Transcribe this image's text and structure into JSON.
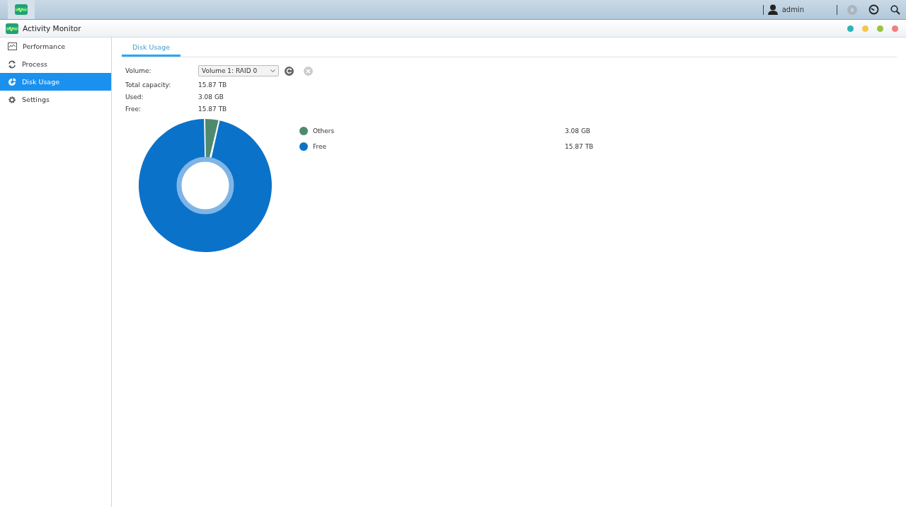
{
  "taskbar": {
    "user": "admin"
  },
  "window": {
    "title": "Activity Monitor",
    "controls": [
      {
        "color": "#2eb3b5"
      },
      {
        "color": "#f5c74a"
      },
      {
        "color": "#9bc23c"
      },
      {
        "color": "#f27e7e"
      }
    ]
  },
  "sidebar": {
    "items": [
      {
        "kind": "performance",
        "label": "Performance",
        "selected": false
      },
      {
        "kind": "process",
        "label": "Process",
        "selected": false
      },
      {
        "kind": "disk",
        "label": "Disk Usage",
        "selected": true
      },
      {
        "kind": "settings",
        "label": "Settings",
        "selected": false
      }
    ]
  },
  "tabs": [
    {
      "label": "Disk Usage",
      "selected": true
    }
  ],
  "volume": {
    "label": "Volume:",
    "value": "Volume 1: RAID 0"
  },
  "info": [
    {
      "label": "Total capacity:",
      "value": "15.87 TB"
    },
    {
      "label": "Used:",
      "value": "3.08 GB"
    },
    {
      "label": "Free:",
      "value": "15.87 TB"
    }
  ],
  "legend": [
    {
      "name": "Others",
      "value": "3.08 GB",
      "color": "#4f8a6e"
    },
    {
      "name": "Free",
      "value": "15.87 TB",
      "color": "#0b72c9"
    }
  ]
}
